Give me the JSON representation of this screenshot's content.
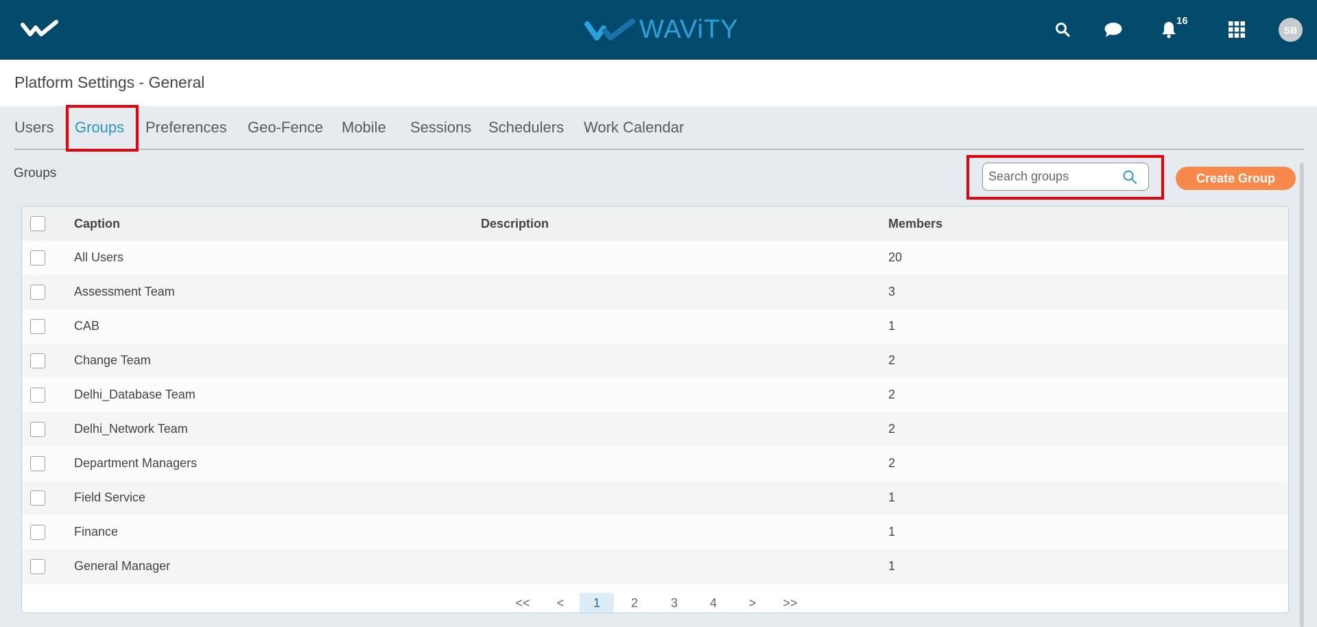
{
  "app": {
    "brand_name": "WAViTY",
    "notification_count": "16",
    "avatar_initials": "SB",
    "colors": {
      "topbar": "#024a6c",
      "accent": "#2c95c4",
      "button": "#f7894a",
      "highlight": "#e8000b"
    },
    "icons": [
      "logo-icon",
      "search-icon",
      "chat-icon",
      "bell-icon",
      "apps-grid-icon"
    ]
  },
  "page": {
    "title": "Platform Settings - General"
  },
  "tabs": [
    {
      "label": "Users"
    },
    {
      "label": "Groups"
    },
    {
      "label": "Preferences"
    },
    {
      "label": "Geo-Fence"
    },
    {
      "label": "Mobile"
    },
    {
      "label": "Sessions"
    },
    {
      "label": "Schedulers"
    },
    {
      "label": "Work Calendar"
    }
  ],
  "active_tab": "Groups",
  "groups": {
    "section_label": "Groups",
    "search_placeholder": "Search groups",
    "create_label": "Create Group",
    "columns": {
      "caption": "Caption",
      "description": "Description",
      "members": "Members"
    },
    "rows": [
      {
        "caption": "All Users",
        "description": "",
        "members": "20"
      },
      {
        "caption": "Assessment Team",
        "description": "",
        "members": "3"
      },
      {
        "caption": "CAB",
        "description": "",
        "members": "1"
      },
      {
        "caption": "Change Team",
        "description": "",
        "members": "2"
      },
      {
        "caption": "Delhi_Database Team",
        "description": "",
        "members": "2"
      },
      {
        "caption": "Delhi_Network Team",
        "description": "",
        "members": "2"
      },
      {
        "caption": "Department Managers",
        "description": "",
        "members": "2"
      },
      {
        "caption": "Field Service",
        "description": "",
        "members": "1"
      },
      {
        "caption": "Finance",
        "description": "",
        "members": "1"
      },
      {
        "caption": "General Manager",
        "description": "",
        "members": "1"
      }
    ]
  },
  "pagination": {
    "first": "<<",
    "prev": "<",
    "pages": [
      "1",
      "2",
      "3",
      "4"
    ],
    "current": "1",
    "next": ">",
    "last": ">>"
  }
}
